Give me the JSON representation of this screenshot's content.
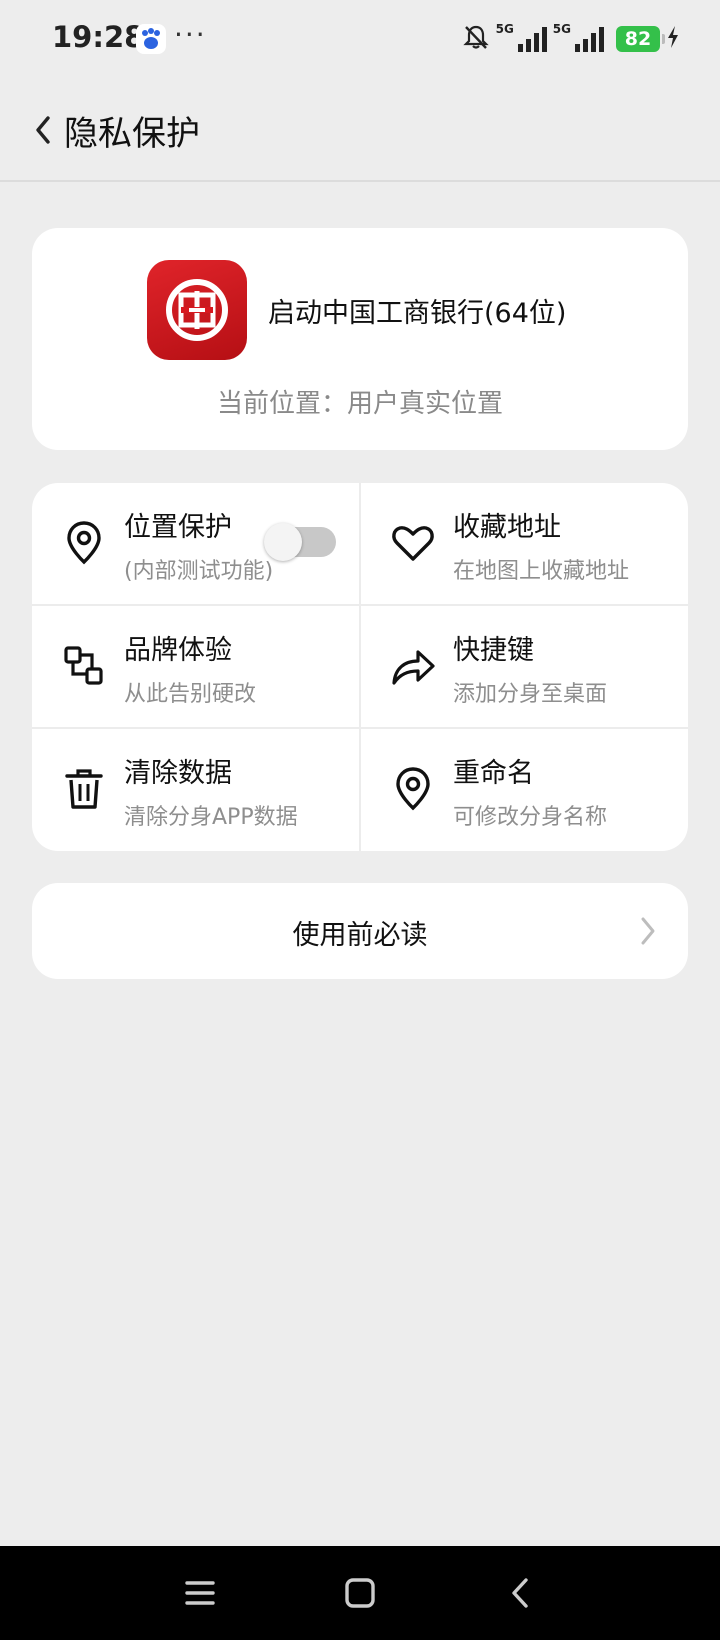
{
  "status_bar": {
    "time": "19:28",
    "more": "···",
    "network_1": "5G",
    "network_2": "5G",
    "battery": "82"
  },
  "header": {
    "title": "隐私保护",
    "back_icon": "chevron-left-icon"
  },
  "app_card": {
    "app_name": "启动中国工商银行(64位)",
    "location": "当前位置：用户真实位置",
    "brand_color": "#d71920"
  },
  "features": [
    {
      "title": "位置保护",
      "subtitle": "(内部测试功能)",
      "icon": "location-pin-icon",
      "toggle_on": false
    },
    {
      "title": "收藏地址",
      "subtitle": "在地图上收藏地址",
      "icon": "heart-icon"
    },
    {
      "title": "品牌体验",
      "subtitle": "从此告别硬改",
      "icon": "brand-swap-icon"
    },
    {
      "title": "快捷键",
      "subtitle": "添加分身至桌面",
      "icon": "share-arrow-icon"
    },
    {
      "title": "清除数据",
      "subtitle": "清除分身APP数据",
      "icon": "trash-icon"
    },
    {
      "title": "重命名",
      "subtitle": "可修改分身名称",
      "icon": "location-pin-icon"
    }
  ],
  "notice": {
    "label": "使用前必读"
  }
}
